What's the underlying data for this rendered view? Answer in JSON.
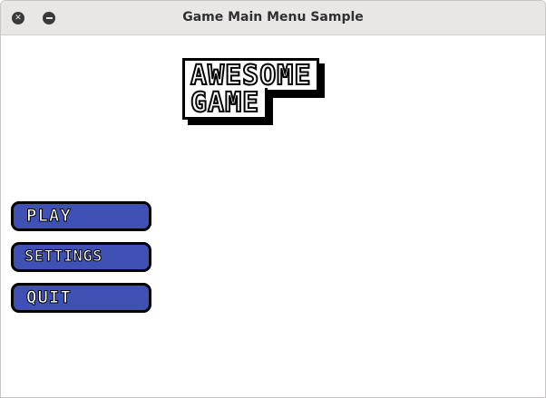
{
  "window": {
    "title": "Game Main Menu Sample",
    "close_symbol": "✕",
    "minimize_symbol": "–"
  },
  "logo": {
    "line1": "AWESOME",
    "line2": "GAME"
  },
  "menu": {
    "items": [
      {
        "label": "PLAY"
      },
      {
        "label": "SETTINGS"
      },
      {
        "label": "QUIT"
      }
    ]
  },
  "colors": {
    "button_fill": "#3f51b5",
    "outline": "#000000",
    "titlebar": "#e8e7e4"
  }
}
